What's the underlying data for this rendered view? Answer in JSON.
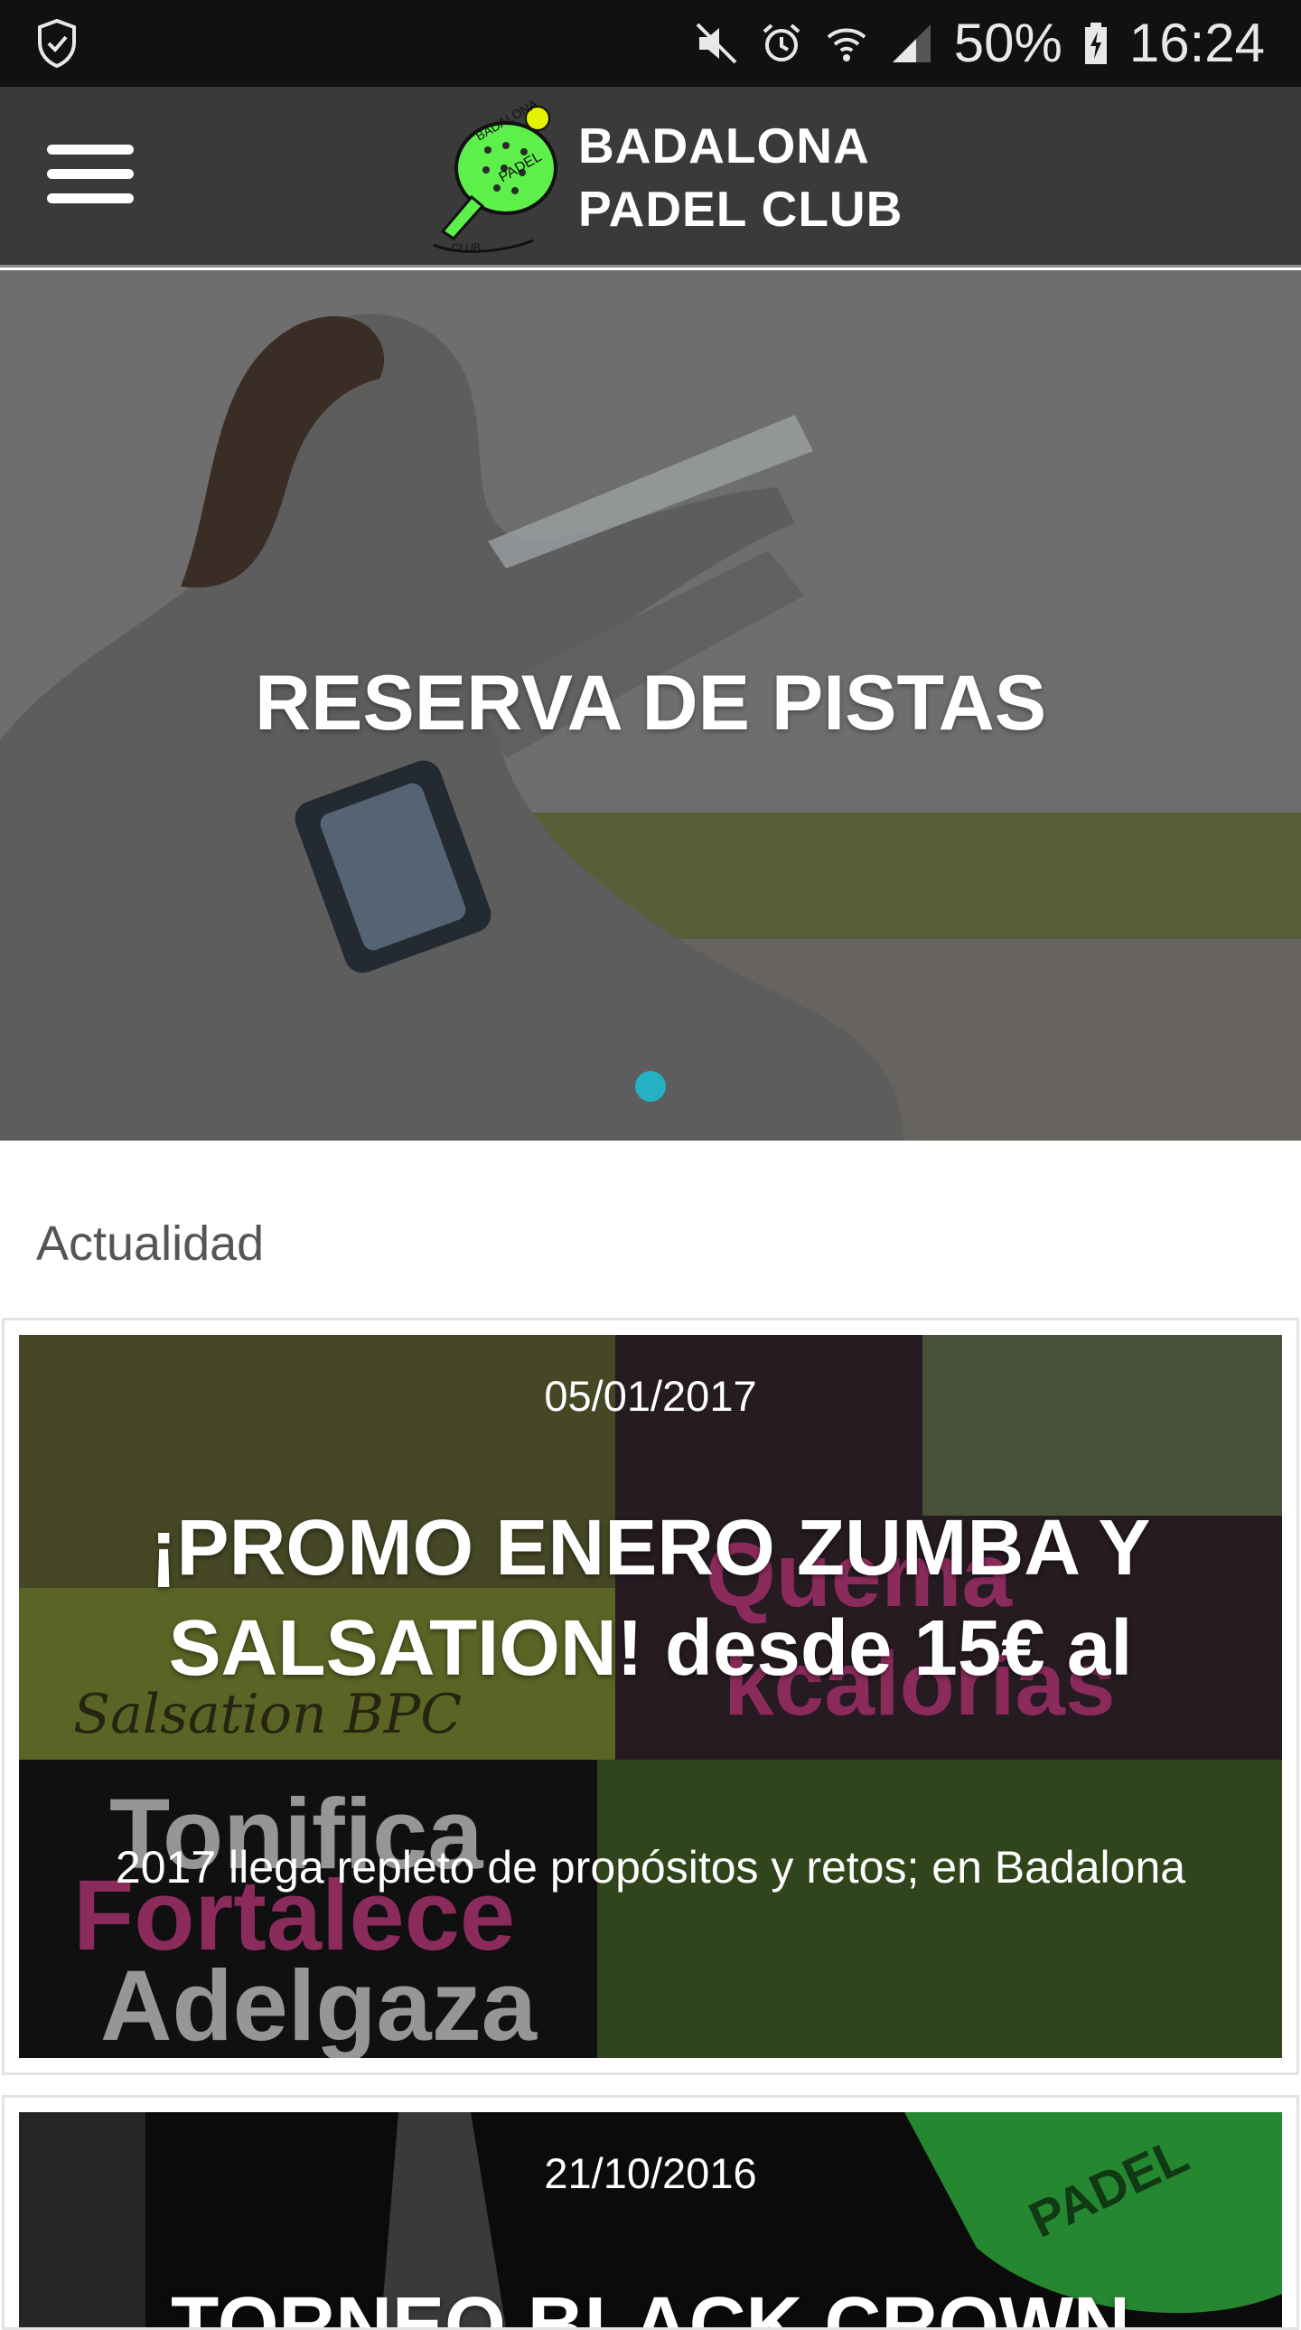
{
  "status_bar": {
    "battery_percent": "50%",
    "time": "16:24",
    "icons": [
      "shield-icon",
      "mute-icon",
      "alarm-icon",
      "wifi-icon",
      "signal-icon",
      "battery-icon"
    ]
  },
  "app_bar": {
    "menu_icon": "hamburger-menu-icon",
    "logo": {
      "line1": "BADALONA",
      "line2": "PADEL CLUB",
      "mark_text": [
        "BADALONA",
        "PADEL",
        "CLUB"
      ],
      "brand_color": "#5ef04a"
    }
  },
  "hero": {
    "title": "RESERVA DE PISTAS",
    "active_slide": 1,
    "slide_count": 1,
    "indicator_color": "#26b0c4"
  },
  "news": {
    "section_title": "Actualidad",
    "items": [
      {
        "date": "05/01/2017",
        "headline_line1": "¡PROMO ENERO ZUMBA Y",
        "headline_line2": "SALSATION! desde 15€ al",
        "excerpt": "2017 llega repleto de propósitos y retos; en Badalona",
        "image_text": [
          "Salsation BPC",
          "Quema",
          "kcalorías",
          "Tonifica",
          "Fortalece",
          "Adelgaza"
        ]
      },
      {
        "date": "21/10/2016",
        "headline_line1": "TORNEO BLACK CROWN",
        "image_text": [
          "PADEL"
        ]
      }
    ]
  }
}
